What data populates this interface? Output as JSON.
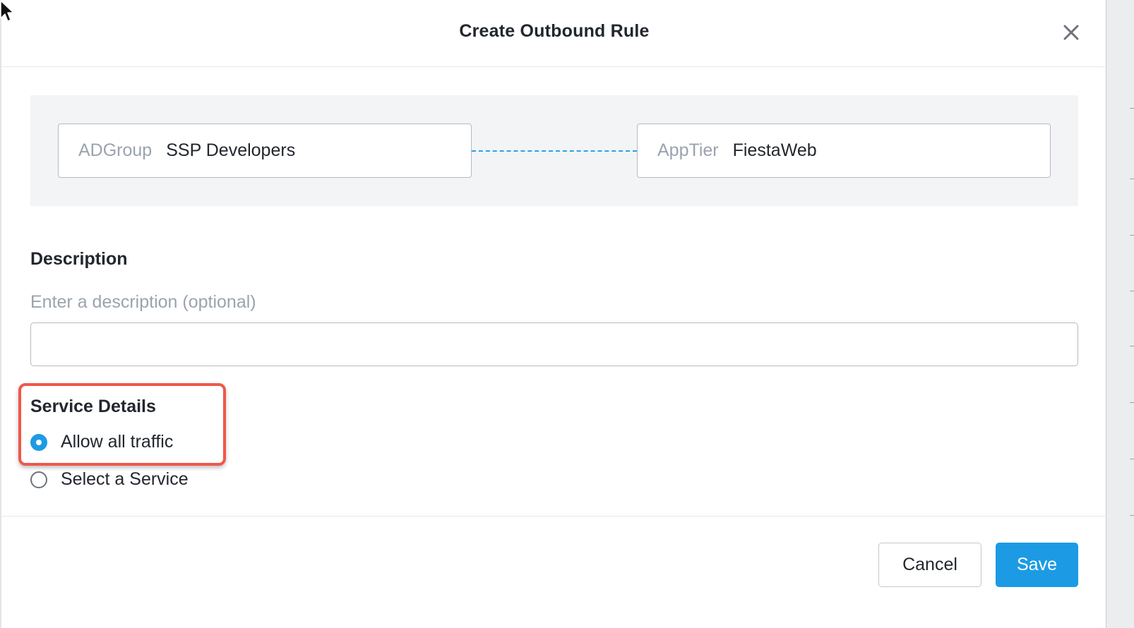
{
  "dialog": {
    "title": "Create Outbound Rule",
    "close_icon": "close-icon"
  },
  "flow": {
    "source": {
      "type": "ADGroup",
      "name": "SSP Developers"
    },
    "destination": {
      "type": "AppTier",
      "name": "FiestaWeb"
    }
  },
  "description": {
    "label": "Description",
    "placeholder": "Enter a description (optional)",
    "value": ""
  },
  "service_details": {
    "label": "Service Details",
    "options": [
      {
        "label": "Allow all traffic",
        "selected": true
      },
      {
        "label": "Select a Service",
        "selected": false
      }
    ]
  },
  "footer": {
    "cancel_label": "Cancel",
    "save_label": "Save"
  },
  "colors": {
    "accent": "#1c9be4",
    "highlight": "#f0574b",
    "muted_text": "#9ba3ad"
  },
  "icons": [
    "mouse-cursor-icon",
    "close-icon",
    "radio-checked-icon",
    "radio-unchecked-icon"
  ]
}
